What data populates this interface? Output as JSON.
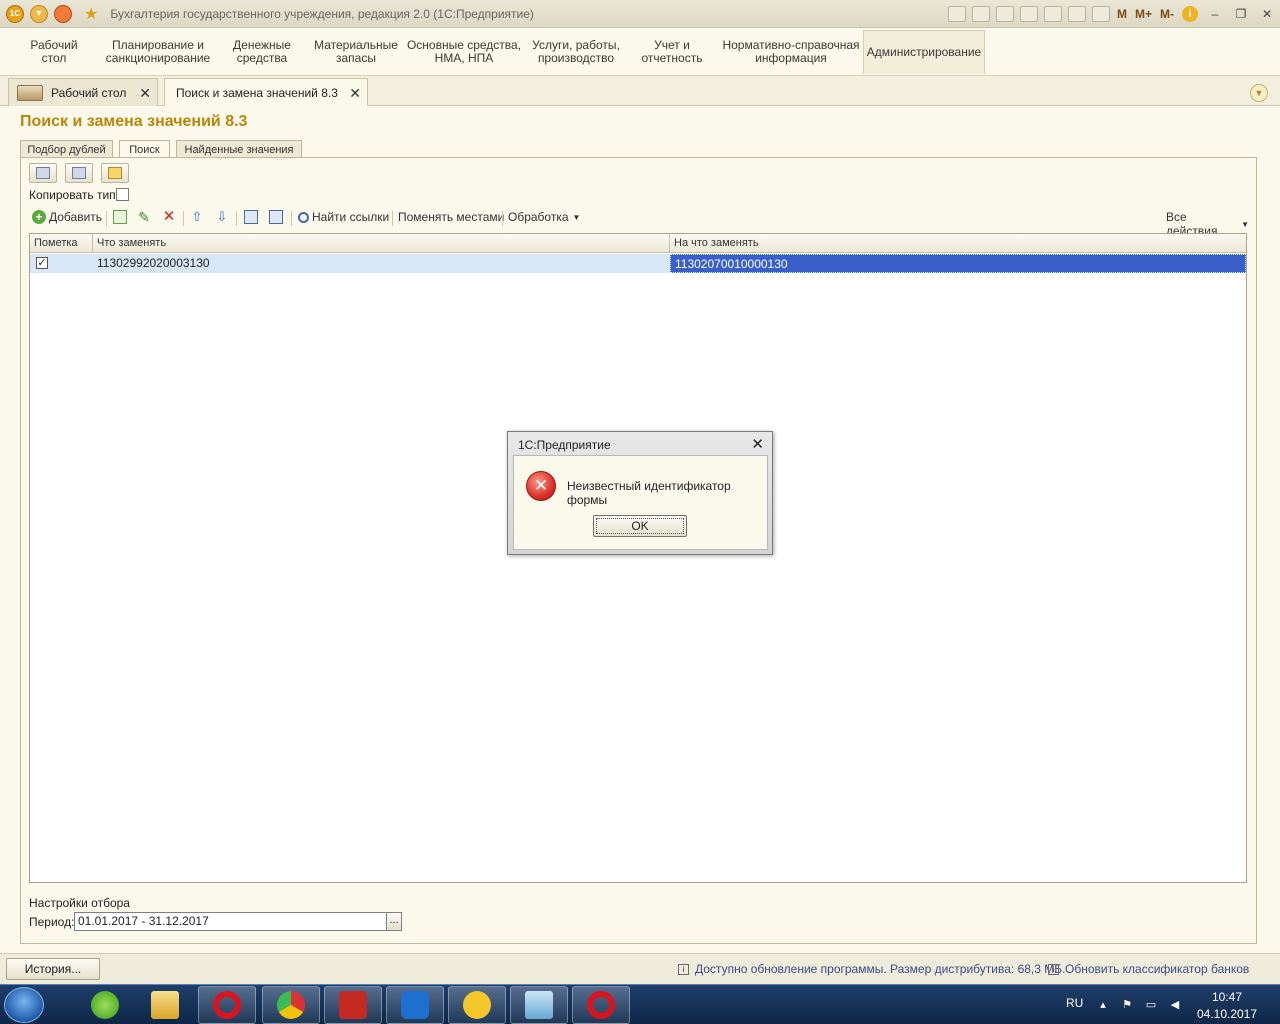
{
  "window": {
    "title": "Бухгалтерия государственного учреждения, редакция 2.0  (1С:Предприятие)",
    "logo_text": "1С",
    "menu_buttons": [
      "M",
      "M+",
      "M-"
    ]
  },
  "sections": [
    {
      "label": "Рабочий\nстол"
    },
    {
      "label": "Планирование и\nсанкционирование"
    },
    {
      "label": "Денежные\nсредства"
    },
    {
      "label": "Материальные\nзапасы"
    },
    {
      "label": "Основные средства,\nНМА, НПА"
    },
    {
      "label": "Услуги, работы,\nпроизводство"
    },
    {
      "label": "Учет и\nотчетность"
    },
    {
      "label": "Нормативно-справочная\nинформация"
    },
    {
      "label": "Администрирование"
    }
  ],
  "open_tabs": [
    {
      "label": "Рабочий стол"
    },
    {
      "label": "Поиск и замена значений 8.3"
    }
  ],
  "form": {
    "title": "Поиск и замена значений 8.3",
    "tabs": [
      "Подбор дублей",
      "Поиск",
      "Найденные значения"
    ],
    "active_tab": "Поиск",
    "copy_type_label": "Копировать тип:",
    "copy_type_checked": false,
    "toolbar": {
      "add": "Добавить",
      "find_refs": "Найти ссылки",
      "swap": "Поменять местами",
      "processing": "Обработка",
      "all_actions": "Все действия"
    },
    "table": {
      "columns": [
        "Пометка",
        "Что заменять",
        "На что заменять"
      ],
      "rows": [
        {
          "checked": true,
          "what": "11302992020003130",
          "to": "11302070010000130"
        }
      ]
    },
    "filter_settings_label": "Настройки отбора",
    "period_label": "Период:",
    "period_value": "01.01.2017 - 31.12.2017",
    "period_button": "..."
  },
  "dialog": {
    "title": "1С:Предприятие",
    "message": "Неизвестный идентификатор формы",
    "ok_label": "OK",
    "close": "✕"
  },
  "statusbar": {
    "history_button": "История...",
    "update_msg": "Доступно обновление программы. Размер дистрибутива: 68,3 МБ.",
    "classifier_msg": "Обновить классификатор банков"
  },
  "taskbar": {
    "lang": "RU",
    "time": "10:47",
    "date": "04.10.2017",
    "apps": [
      "icq",
      "explorer",
      "opera",
      "chrome",
      "acrobat",
      "teamviewer",
      "1c",
      "notepad",
      "opera"
    ]
  },
  "colors": {
    "title_accent": "#b8860b",
    "selected_cell": "#3a5fc8",
    "selected_row": "#d8e6f7",
    "status_link": "#3b4a8c"
  }
}
